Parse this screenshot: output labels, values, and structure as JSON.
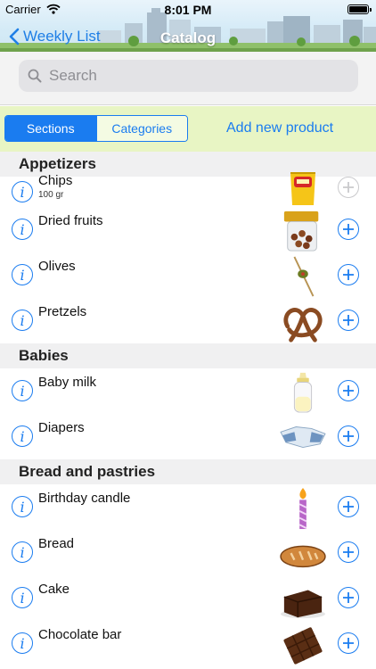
{
  "status_bar": {
    "carrier": "Carrier",
    "time": "8:01 PM"
  },
  "nav": {
    "back_label": "Weekly List",
    "title": "Catalog"
  },
  "search": {
    "placeholder": "Search"
  },
  "toolbar": {
    "segments": [
      "Sections",
      "Categories"
    ],
    "selected_segment": "Sections",
    "add_product_label": "Add new product"
  },
  "sections": [
    {
      "title": "Appetizers",
      "items": [
        {
          "name": "Chips",
          "detail": "100 gr",
          "image": "chips-bag",
          "added": false
        },
        {
          "name": "Dried fruits",
          "detail": "",
          "image": "dried-fruit-jar"
        },
        {
          "name": "Olives",
          "detail": "",
          "image": "olive-skewer"
        },
        {
          "name": "Pretzels",
          "detail": "",
          "image": "pretzel"
        }
      ]
    },
    {
      "title": "Babies",
      "items": [
        {
          "name": "Baby milk",
          "detail": "",
          "image": "baby-bottle"
        },
        {
          "name": "Diapers",
          "detail": "",
          "image": "diaper"
        }
      ]
    },
    {
      "title": "Bread and pastries",
      "items": [
        {
          "name": "Birthday candle",
          "detail": "",
          "image": "birthday-candle"
        },
        {
          "name": "Bread",
          "detail": "",
          "image": "bread-loaf"
        },
        {
          "name": "Cake",
          "detail": "",
          "image": "chocolate-cake"
        },
        {
          "name": "Chocolate bar",
          "detail": "",
          "image": "chocolate-bar"
        }
      ]
    }
  ],
  "colors": {
    "accent": "#1a7cf0",
    "toolbar_bg": "#e8f5c4",
    "section_header_bg": "#f0f0f1",
    "disabled": "#c9c9cc"
  }
}
